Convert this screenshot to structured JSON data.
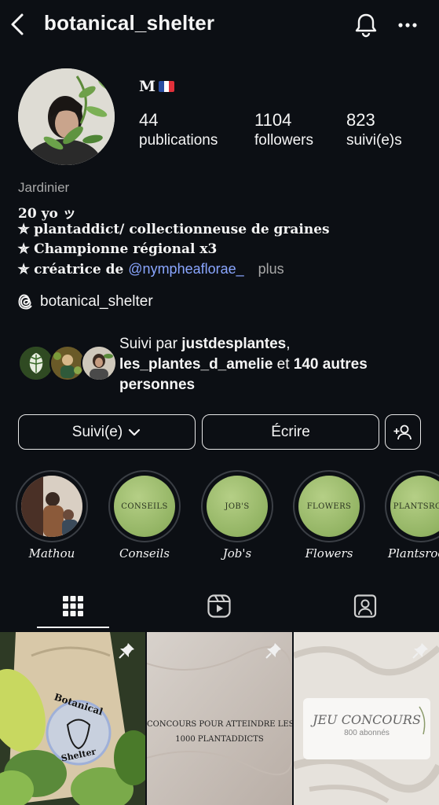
{
  "header": {
    "username": "botanical_shelter"
  },
  "profile": {
    "display_name": "M",
    "stats": {
      "posts": {
        "value": "44",
        "label": "publications"
      },
      "followers": {
        "value": "1104",
        "label": "followers"
      },
      "following": {
        "value": "823",
        "label": "suivi(e)s"
      }
    },
    "category": "Jardinier",
    "bio": {
      "line1": "20 yo ッ",
      "line2": "✯ plantaddict/ collectionneuse de graines",
      "line3": "✯ Championne régional x3",
      "line4_prefix": "✯ créatrice de ",
      "mention": "@nympheaflorae_",
      "more": "plus"
    },
    "threads_handle": "botanical_shelter"
  },
  "followed_by": {
    "prefix": "Suivi par ",
    "user1": "justdesplantes",
    "sep": ",",
    "user2": "les_plantes_d_amelie",
    "mid": " et ",
    "others": "140 autres personnes"
  },
  "actions": {
    "following_label": "Suivi(e)",
    "message_label": "Écrire"
  },
  "highlights": [
    {
      "label": "Mathou",
      "cover_text": ""
    },
    {
      "label": "Conseils",
      "cover_text": "CONSEILS"
    },
    {
      "label": "Job's",
      "cover_text": "JOB'S"
    },
    {
      "label": "Flowers",
      "cover_text": "FLOWERS"
    },
    {
      "label": "Plantsroo",
      "cover_text": "PLANTSROO"
    }
  ],
  "posts": [
    {
      "sticker_top": "Botanical",
      "sticker_bottom": "Shelter"
    },
    {
      "text_line1": "CONCOURS POUR ATTEINDRE LES",
      "text_line2": "1000 PLANTADDICTS"
    },
    {
      "card_title": "JEU CONCOURS",
      "card_sub": "800 abonnés"
    }
  ],
  "colors": {
    "background": "#0c0f14",
    "mention": "#8aa6ff",
    "muted": "#a8a8a8",
    "highlight_green": "#9fbd6e"
  }
}
